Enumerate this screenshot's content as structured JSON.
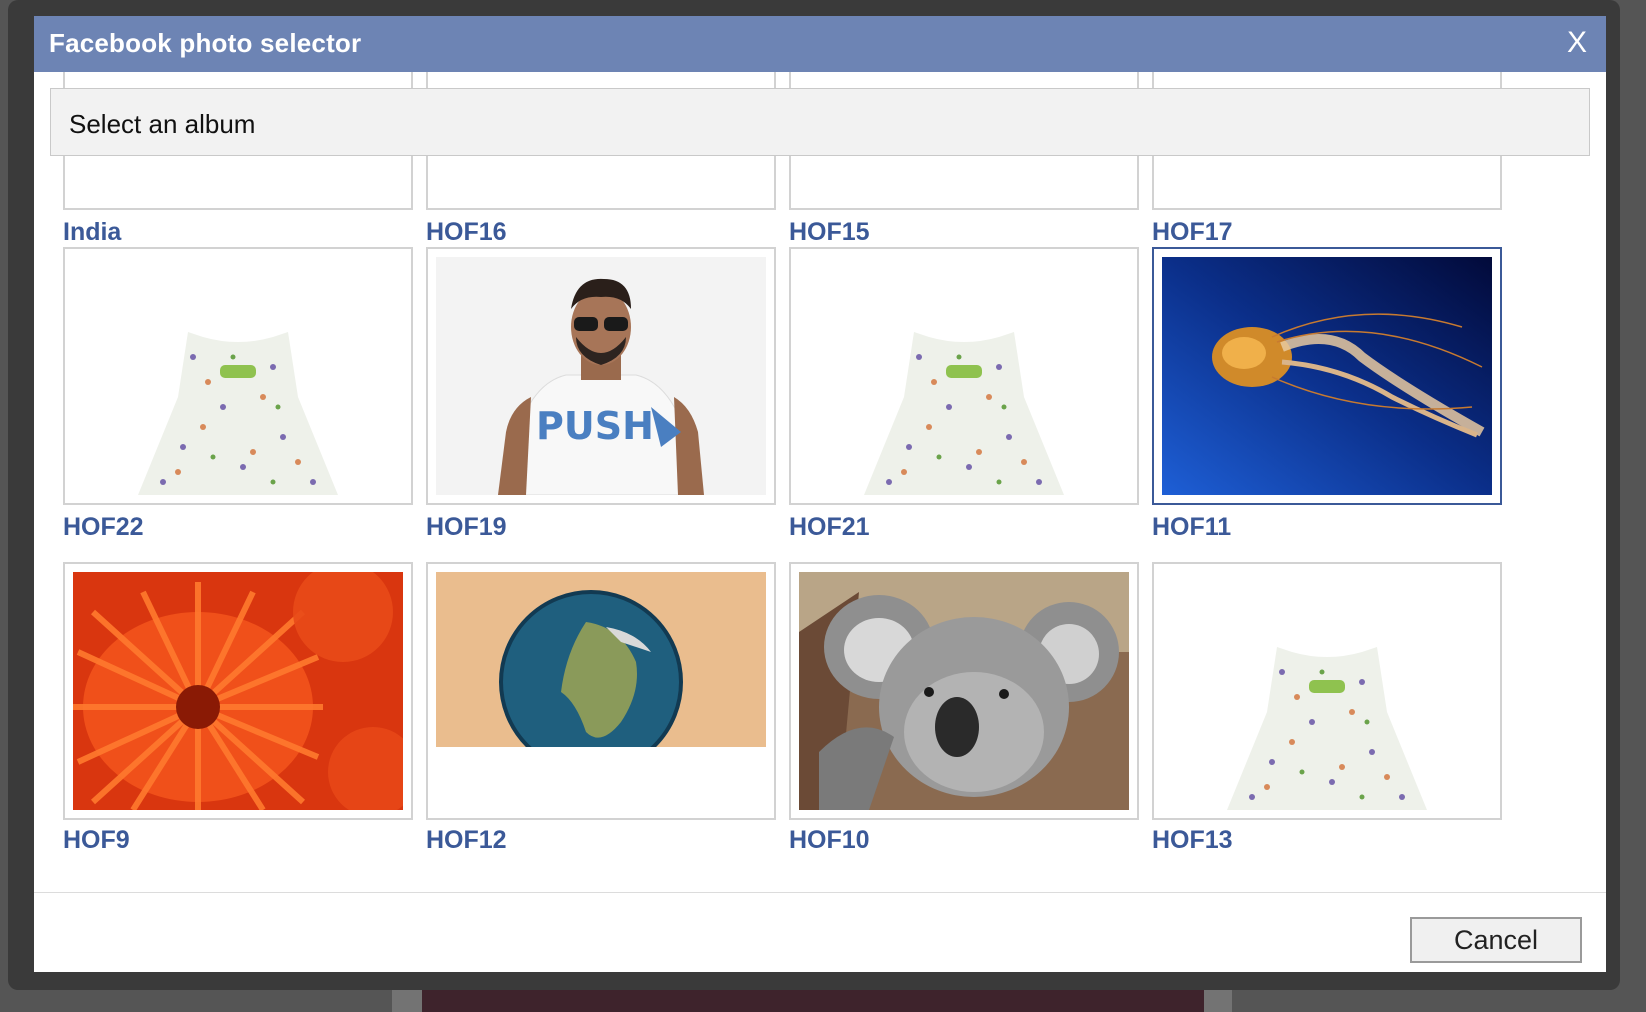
{
  "dialog": {
    "title": "Facebook photo selector",
    "close_label": "X",
    "section_title": "Select an album",
    "cancel_label": "Cancel"
  },
  "albums_partial": [
    {
      "label": "India"
    },
    {
      "label": "HOF16"
    },
    {
      "label": "HOF15"
    },
    {
      "label": "HOF17"
    }
  ],
  "albums": [
    {
      "label": "HOF22",
      "thumb": "dress-icon"
    },
    {
      "label": "HOF19",
      "thumb": "man-portrait-icon"
    },
    {
      "label": "HOF21",
      "thumb": "dress-icon"
    },
    {
      "label": "HOF11",
      "thumb": "jellyfish-icon",
      "selected": true
    },
    {
      "label": "HOF9",
      "thumb": "flower-icon"
    },
    {
      "label": "HOF12",
      "thumb": "globe-icon"
    },
    {
      "label": "HOF10",
      "thumb": "koala-icon"
    },
    {
      "label": "HOF13",
      "thumb": "dress-icon"
    }
  ],
  "colors": {
    "titlebar": "#6d84b4",
    "album_label": "#3b5998",
    "selected_border": "#3b5998"
  }
}
